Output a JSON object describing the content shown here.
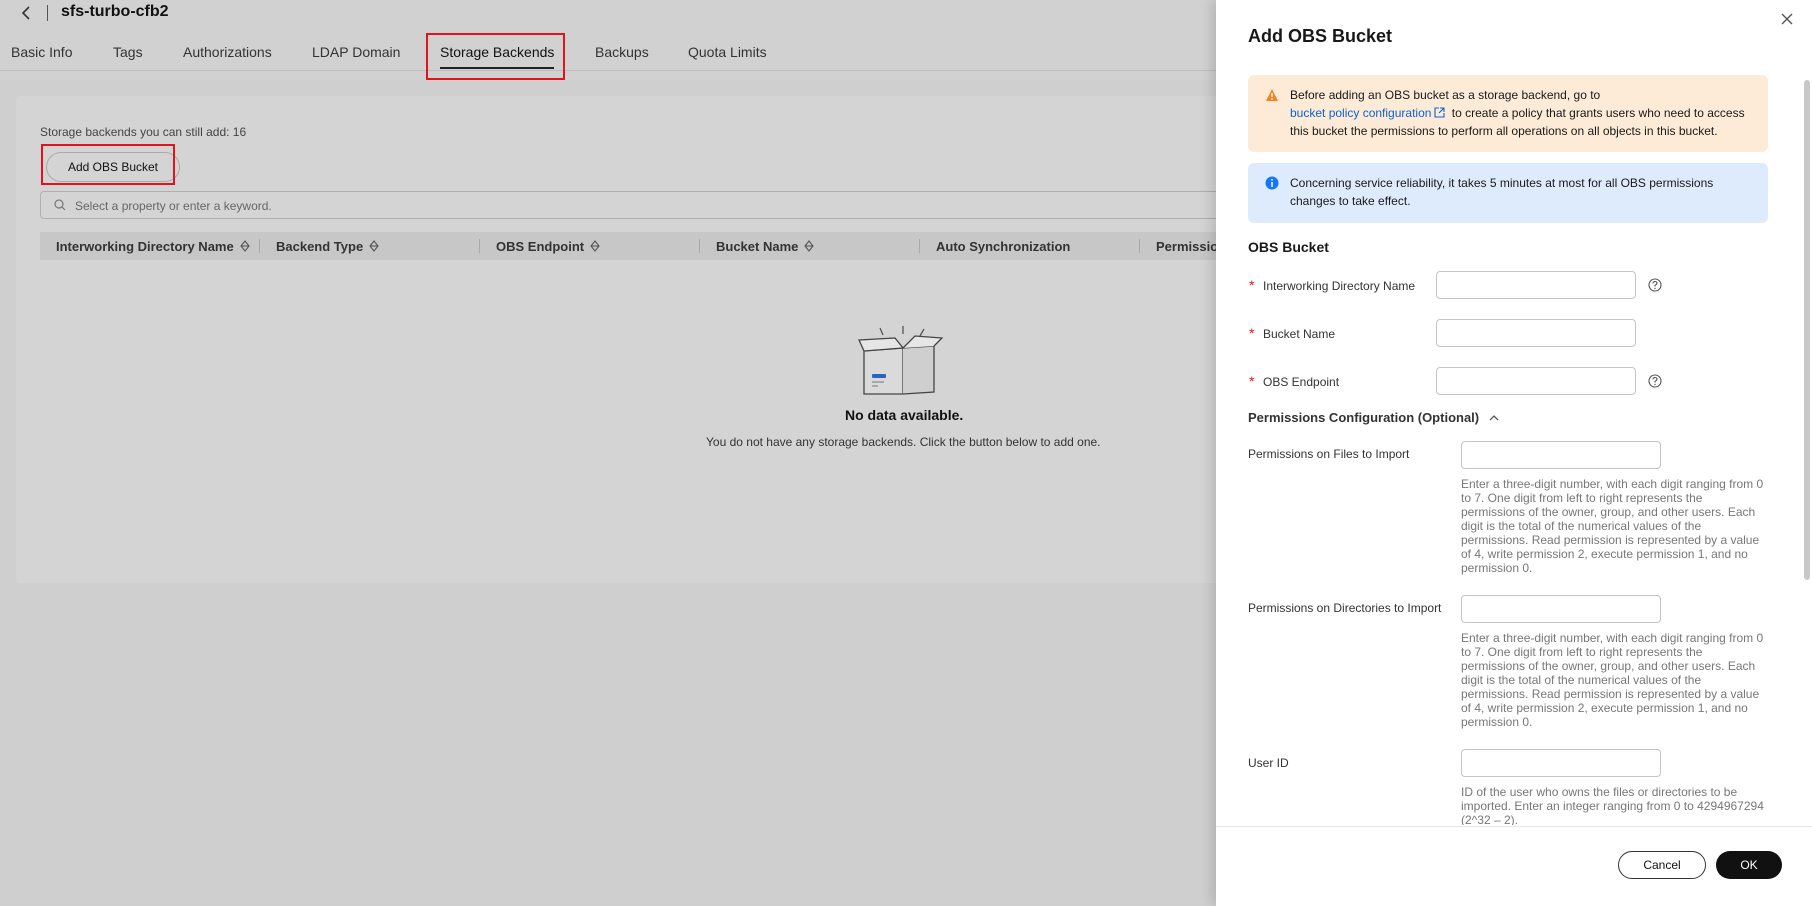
{
  "page": {
    "title": "sfs-turbo-cfb2",
    "tabs": [
      {
        "label": "Basic Info"
      },
      {
        "label": "Tags"
      },
      {
        "label": "Authorizations"
      },
      {
        "label": "LDAP Domain"
      },
      {
        "label": "Storage Backends",
        "active": true
      },
      {
        "label": "Backups"
      },
      {
        "label": "Quota Limits"
      }
    ],
    "quota_text": "Storage backends you can still add: 16",
    "add_button": "Add OBS Bucket",
    "search_placeholder": "Select a property or enter a keyword.",
    "table": {
      "columns": [
        "Interworking Directory Name",
        "Backend Type",
        "OBS Endpoint",
        "Bucket Name",
        "Auto Synchronization",
        "Permissio"
      ]
    },
    "empty": {
      "title": "No data available.",
      "description": "You do not have any storage backends. Click the button below to add one."
    }
  },
  "drawer": {
    "title": "Add OBS Bucket",
    "warning": {
      "text_before": "Before adding an OBS bucket as a storage backend, go to",
      "link": "bucket policy configuration",
      "text_after": "to create a policy that grants users who need to access this bucket the permissions to perform all operations on all objects in this bucket."
    },
    "info": "Concerning service reliability, it takes 5 minutes at most for all OBS permissions changes to take effect.",
    "section_title": "OBS Bucket",
    "fields": {
      "dir_name": "Interworking Directory Name",
      "bucket_name": "Bucket Name",
      "endpoint": "OBS Endpoint"
    },
    "permissions_title": "Permissions Configuration (Optional)",
    "perm_files_label": "Permissions on Files to Import",
    "perm_files_hint": "Enter a three-digit number, with each digit ranging from 0 to 7. One digit from left to right represents the permissions of the owner, group, and other users. Each digit is the total of the numerical values of the permissions. Read permission is represented by a value of 4, write permission 2, execute permission 1, and no permission 0.",
    "perm_dirs_label": "Permissions on Directories to Import",
    "perm_dirs_hint": "Enter a three-digit number, with each digit ranging from 0 to 7. One digit from left to right represents the permissions of the owner, group, and other users. Each digit is the total of the numerical values of the permissions. Read permission is represented by a value of 4, write permission 2, execute permission 1, and no permission 0.",
    "user_id_label": "User ID",
    "user_id_hint": "ID of the user who owns the files or directories to be imported. Enter an integer ranging from 0 to 4294967294 (2^32 – 2).",
    "cancel": "Cancel",
    "ok": "OK"
  },
  "colors": {
    "highlight": "#e0141c",
    "link": "#0b63ce",
    "warning_bg": "#fdebd8",
    "info_bg": "#deebfd"
  }
}
